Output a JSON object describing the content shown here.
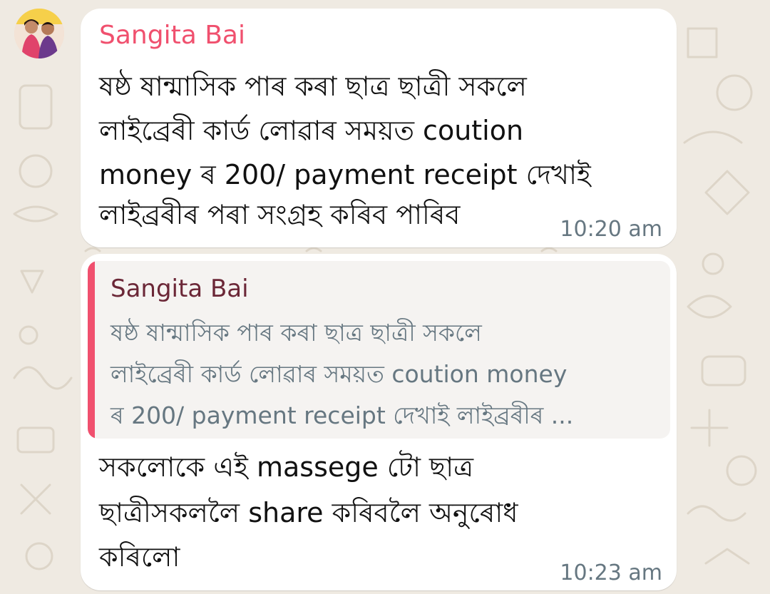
{
  "chat": {
    "theme": {
      "wallpaper_color": "#efeae2",
      "bubble_color": "#ffffff",
      "sender_color": "#f0506e",
      "quote_bar_color": "#f0506e",
      "quote_sender_color": "#6b2737",
      "time_color": "#667781"
    },
    "messages": [
      {
        "sender": "Sangita Bai",
        "avatar": "couple-photo-avatar",
        "lines": [
          "ষষ্ঠ ষান্মাসিক পাৰ কৰা ছাত্ৰ ছাত্ৰী সকলে",
          "লাইব্ৰেৰী কাৰ্ড লোৱাৰ সময়ত coution",
          "money ৰ 200/ payment receipt দেখাই",
          "লাইব্ৰৰীৰ পৰা সংগ্ৰহ কৰিব পাৰিব"
        ],
        "time": "10:20 am"
      },
      {
        "quote": {
          "sender": "Sangita Bai",
          "lines": [
            "ষষ্ঠ ষান্মাসিক পাৰ কৰা ছাত্ৰ ছাত্ৰী সকলে",
            "লাইব্ৰেৰী কাৰ্ড লোৱাৰ সময়ত coution money",
            "ৰ 200/ payment receipt দেখাই লাইব্ৰৰীৰ ..."
          ]
        },
        "lines": [
          "সকলোকে এই massege টো ছাত্ৰ",
          "ছাত্ৰীসকললৈ share কৰিবলৈ অনুৰোধ",
          "কৰিলো"
        ],
        "time": "10:23 am"
      }
    ]
  }
}
